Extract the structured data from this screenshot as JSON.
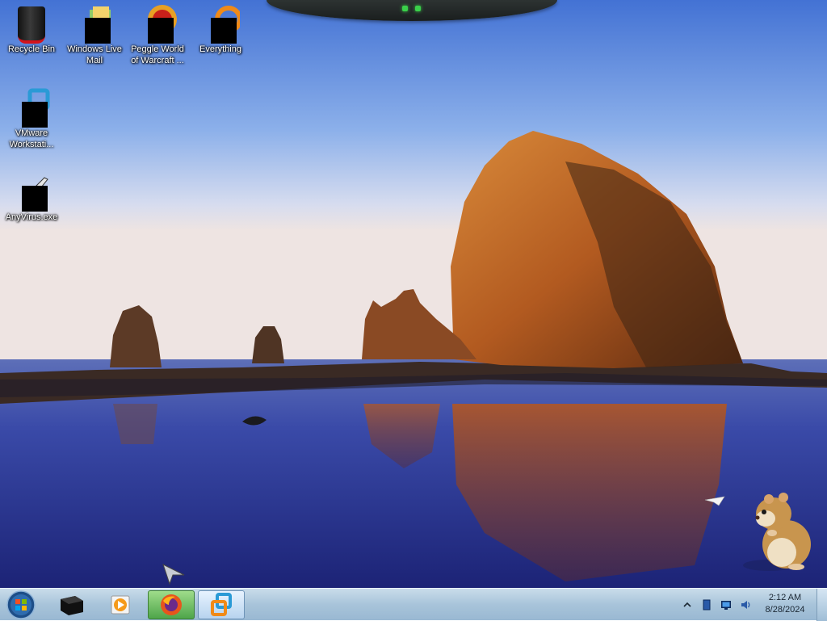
{
  "desktop": {
    "icons": [
      {
        "label": "Recycle Bin"
      },
      {
        "label": "Windows Live Mail"
      },
      {
        "label": "Peggle World of Warcraft ..."
      },
      {
        "label": "Everything"
      },
      {
        "label": "VMware Workstati..."
      },
      {
        "label": "AnyVirus.exe"
      }
    ]
  },
  "taskbar": {
    "start_icon": "windows-orb-icon",
    "buttons": [
      {
        "icon": "dark-cube-icon",
        "state": "normal"
      },
      {
        "icon": "media-player-icon",
        "state": "normal"
      },
      {
        "icon": "firefox-icon",
        "state": "running"
      },
      {
        "icon": "vmware-icon",
        "state": "active"
      }
    ],
    "tray": {
      "icons": [
        "show-hidden-chevron-icon",
        "device-icon",
        "network-icon",
        "volume-icon"
      ],
      "time": "2:12 AM",
      "date": "8/28/2024"
    }
  },
  "colors": {
    "sky_top": "#4d7ad6",
    "sky_horizon": "#e8e2e6",
    "water": "#2a2f8c",
    "rock": "#b05a1e",
    "taskbar": "#a8c4da",
    "running_green": "#4ea54a"
  }
}
